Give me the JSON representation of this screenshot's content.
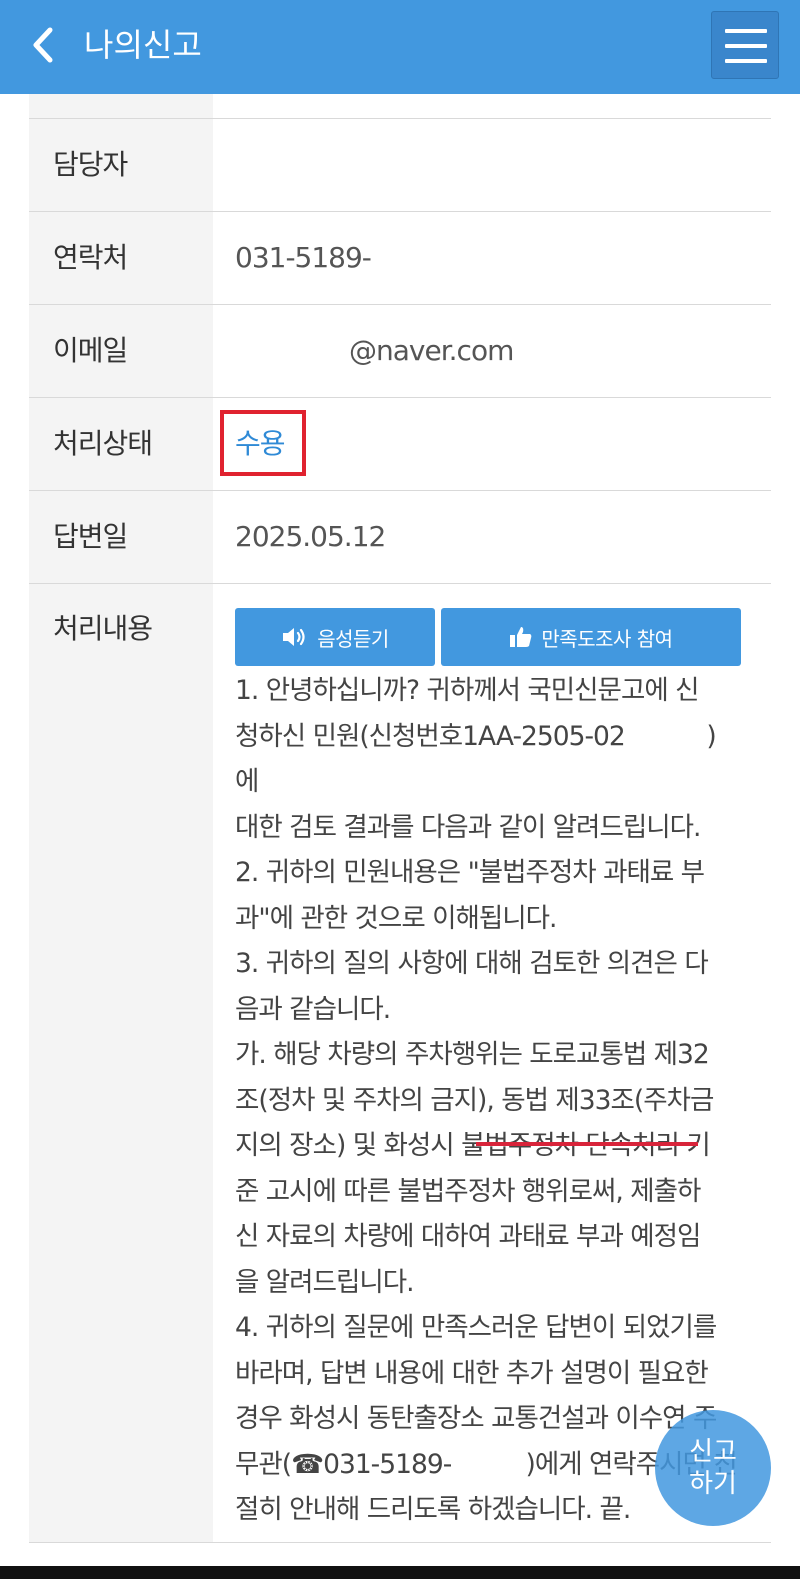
{
  "header": {
    "title": "나의신고",
    "back_icon": "chevron-left-icon",
    "menu_icon": "hamburger-menu-icon"
  },
  "colors": {
    "primary": "#4298df",
    "status_link": "#2f8ad6",
    "highlight_red": "#e0222f"
  },
  "details": {
    "manager": {
      "label": "담당자",
      "value": ""
    },
    "contact": {
      "label": "연락처",
      "value": "031-5189-"
    },
    "email": {
      "label": "이메일",
      "value": "@naver.com"
    },
    "status": {
      "label": "처리상태",
      "value": "수용"
    },
    "answer_date": {
      "label": "답변일",
      "value": "2025.05.12"
    },
    "content": {
      "label": "처리내용",
      "voice_button": "음성듣기",
      "survey_button": "만족도조사 참여",
      "text": "1. 안녕하십니까? 귀하께서 국민신문고에 신\n청하신 민원(신청번호1AA-2505-02           )\n에\n대한 검토 결과를 다음과 같이 알려드립니다.\n2. 귀하의 민원내용은 \"불법주정차 과태료 부\n과\"에 관한 것으로 이해됩니다.\n3. 귀하의 질의 사항에 대해 검토한 의견은 다\n음과 같습니다.\n가. 해당 차량의 주차행위는 도로교통법 제32\n조(정차 및 주차의 금지), 동법 제33조(주차금\n지의 장소) 및 화성시 불법주정차 단속처리 기\n준 고시에 따른 불법주정차 행위로써, 제출하\n신 자료의 차량에 대하여 과태료 부과 예정임\n을 알려드립니다.\n4. 귀하의 질문에 만족스러운 답변이 되었기를\n바라며, 답변 내용에 대한 추가 설명이 필요한\n경우 화성시 동탄출장소 교통건설과 이수연 주\n무관(☎031-5189-          )에게 연락주시면 친\n절히 안내해 드리도록 하겠습니다. 끝."
    }
  },
  "fab": {
    "line1": "신고",
    "line2": "하기"
  }
}
